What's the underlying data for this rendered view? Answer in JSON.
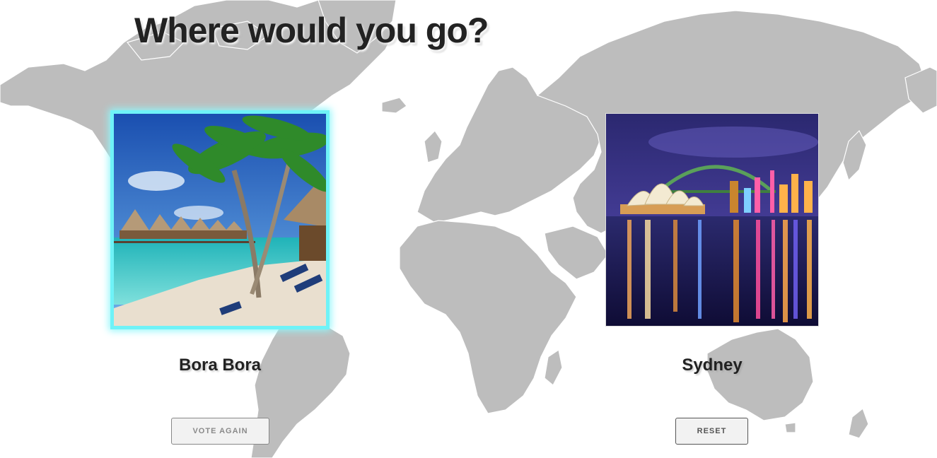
{
  "page": {
    "title": "Where would you go?"
  },
  "destinations": [
    {
      "name": "Bora Bora",
      "image": "beach-bungalows-photo",
      "selected": true
    },
    {
      "name": "Sydney",
      "image": "sydney-opera-house-night-photo",
      "selected": false
    }
  ],
  "buttons": {
    "vote_again": "VOTE AGAIN",
    "reset": "RESET"
  },
  "colors": {
    "map_land": "#bdbdbd",
    "selection_glow": "#6ff2f7",
    "title_text": "#222222"
  }
}
